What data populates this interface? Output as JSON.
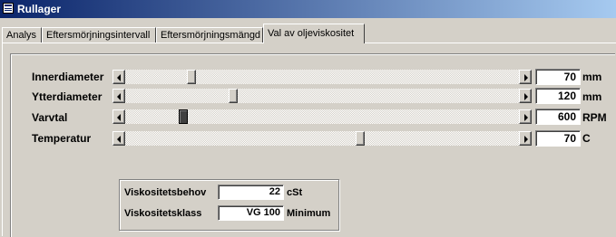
{
  "window": {
    "title": "Rullager",
    "icon": "form-icon"
  },
  "tabs": [
    {
      "label": "Analys",
      "active": false
    },
    {
      "label": "Eftersmörjningsintervall",
      "active": false
    },
    {
      "label": "Eftersmörjningsmängd",
      "active": false
    },
    {
      "label": "Val av oljeviskositet",
      "active": true
    }
  ],
  "sliders": [
    {
      "label": "Innerdiameter",
      "value": "70",
      "unit": "mm",
      "position": 0.16
    },
    {
      "label": "Ytterdiameter",
      "value": "120",
      "unit": "mm",
      "position": 0.27
    },
    {
      "label": "Varvtal",
      "value": "600",
      "unit": "RPM",
      "position": 0.14
    },
    {
      "label": "Temperatur",
      "value": "70",
      "unit": "C",
      "position": 0.6
    }
  ],
  "results": {
    "viscosity_need": {
      "label": "Viskositetsbehov",
      "value": "22",
      "unit": "cSt"
    },
    "viscosity_class": {
      "label": "Viskositetsklass",
      "value": "VG 100",
      "unit": "Minimum"
    }
  }
}
